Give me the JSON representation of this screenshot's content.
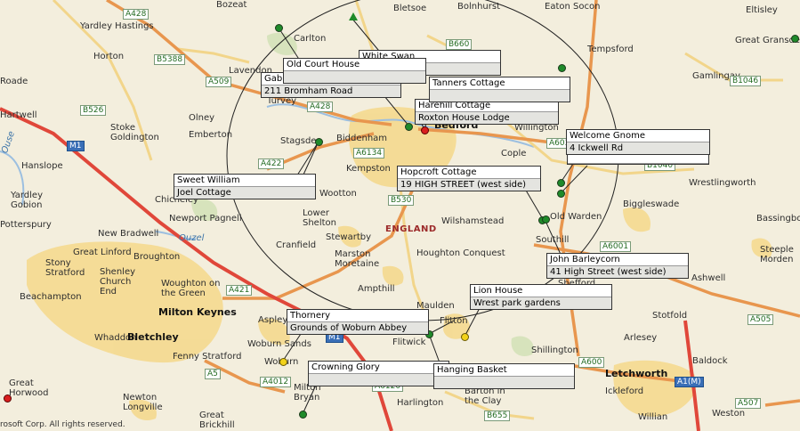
{
  "map": {
    "country": "ENGLAND",
    "copyright": "rosoft Corp. All rights reserved.",
    "rivers": [
      "Ouzel",
      "Ouse"
    ],
    "towns": [
      "Milton Keynes",
      "Bletchley",
      "Letchworth",
      "Bedford"
    ],
    "places": [
      "Bozeat",
      "Bletsoe",
      "Bolnhurst",
      "Eaton Socon",
      "Eltisley",
      "Yardley Hastings",
      "Horton",
      "Carlton",
      "Great Gransden",
      "Lavendon",
      "Tempsford",
      "Gamlingay",
      "Olney",
      "Turvey",
      "Hartwell",
      "Stoke Goldington",
      "Emberton",
      "Willington",
      "Stagsden",
      "Biddenham",
      "Cople",
      "Hanslope",
      "Kempston",
      "Wrestlingworth",
      "Yardley Gobion",
      "Chicheley",
      "Wootton",
      "Potterspury",
      "Newport Pagnell",
      "Lower Shelton",
      "Old Warden",
      "Biggleswade",
      "New Bradwell",
      "Stewartby",
      "Bassingbourn",
      "Cranfield",
      "Wilshamstead",
      "Southill",
      "Great Linford",
      "Broughton",
      "Marston Moretaine",
      "Houghton Conquest",
      "Steeple Morden",
      "Stony Stratford",
      "Shenley Church End",
      "Beachampton",
      "Woughton on the Green",
      "Ampthill",
      "Shefford",
      "Ashwell",
      "Maulden",
      "Aspley",
      "Flitton",
      "Stotfold",
      "Whaddon",
      "Woburn Sands",
      "Flitwick",
      "Arlesey",
      "Fenny Stratford",
      "Woburn",
      "Shillington",
      "Baldock",
      "Milton Bryan",
      "Harlington",
      "Barton in the Clay",
      "Ickleford",
      "Newton Longville",
      "Great Brickhill",
      "Willian",
      "Weston",
      "Great Horwood",
      "Roade"
    ],
    "roads": [
      "A428",
      "B5388",
      "B660",
      "A509",
      "A428",
      "B1046",
      "B526",
      "M1",
      "A6134",
      "A603",
      "A422",
      "B1040",
      "B530",
      "A6001",
      "A421",
      "A505",
      "M1",
      "A600",
      "A5",
      "A4012",
      "A6120",
      "B655",
      "A1(M)",
      "A507"
    ]
  },
  "callouts": [
    {
      "title": "White Swan",
      "subtitle": ""
    },
    {
      "title": "Old Court House",
      "subtitle": ""
    },
    {
      "title": "Gab",
      "subtitle": "211 Bromham Road"
    },
    {
      "title": "Tanners Cottage",
      "subtitle": ""
    },
    {
      "title": "Harehill Cottage",
      "subtitle": "Roxton House Lodge"
    },
    {
      "title": "Welcome Gnome",
      "subtitle": "4 Ickwell Rd"
    },
    {
      "title": "Sweet William",
      "subtitle": "Joel Cottage"
    },
    {
      "title": "Hopcroft Cottage",
      "subtitle": "19 HIGH STREET (west side)"
    },
    {
      "title": "John Barleycorn",
      "subtitle": "41 High Street (west side)"
    },
    {
      "title": "Lion House",
      "subtitle": "Wrest park gardens"
    },
    {
      "title": "Thornery",
      "subtitle": "Grounds of Woburn Abbey"
    },
    {
      "title": "Crowning Glory",
      "subtitle": ""
    },
    {
      "title": "Hanging Basket",
      "subtitle": ""
    }
  ],
  "colors": {
    "land": "#f3eedd",
    "urban": "#f5d78b",
    "motorway": "#e0473a",
    "aroad": "#e8964e",
    "broad": "#f2d58a",
    "water": "#9cbfe0",
    "pin_green": "#1f8a2a",
    "pin_red": "#d91e1e",
    "pin_yellow": "#f2d21a"
  }
}
